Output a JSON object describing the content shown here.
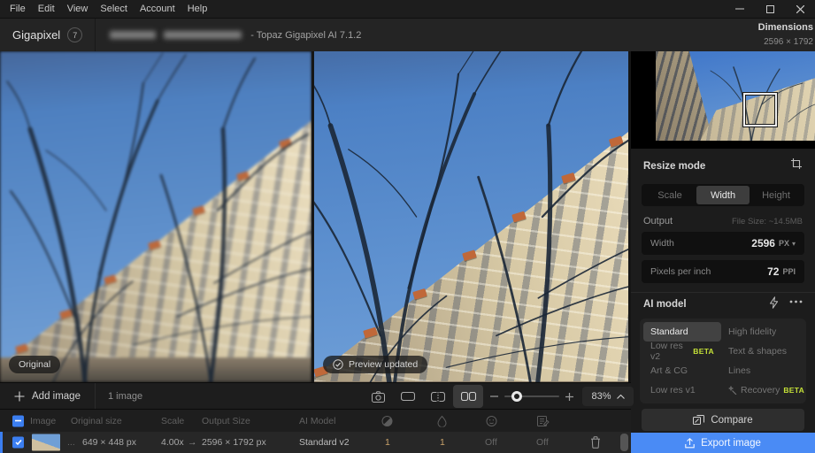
{
  "menu": {
    "items": [
      "File",
      "Edit",
      "View",
      "Select",
      "Account",
      "Help"
    ]
  },
  "titlebar": {
    "app_name": "Gigapixel",
    "version_badge": "7",
    "title_suffix": "- Topaz Gigapixel AI 7.1.2",
    "dimensions_label": "Dimensions",
    "dimensions_value": "2596 × 1792"
  },
  "preview": {
    "original_label": "Original",
    "updated_label": "Preview updated"
  },
  "sidebar": {
    "resize_mode": {
      "label": "Resize mode",
      "tabs": [
        {
          "label": "Scale",
          "active": false
        },
        {
          "label": "Width",
          "active": true
        },
        {
          "label": "Height",
          "active": false
        }
      ]
    },
    "output": {
      "label": "Output",
      "file_size": "File Size: ~14.5MB",
      "width_label": "Width",
      "width_value": "2596",
      "width_unit": "PX",
      "width_caret": "▾",
      "ppi_label": "Pixels per inch",
      "ppi_value": "72",
      "ppi_unit": "PPI"
    },
    "ai_model": {
      "label": "AI model",
      "beta_label": "BETA",
      "models": [
        {
          "label": "Standard",
          "active": true
        },
        {
          "label": "High fidelity",
          "active": false
        },
        {
          "label": "Low res v2",
          "active": false,
          "beta": true
        },
        {
          "label": "Text & shapes",
          "active": false
        },
        {
          "label": "Art & CG",
          "active": false
        },
        {
          "label": "Lines",
          "active": false
        },
        {
          "label": "Low res v1",
          "active": false
        },
        {
          "label": "Recovery",
          "active": false,
          "beta": true
        }
      ]
    },
    "compare_label": "Compare",
    "export_label": "Export image"
  },
  "toolbar": {
    "add_image_label": "Add image",
    "image_count": "1 image",
    "zoom_value": "83%"
  },
  "table": {
    "headers": [
      "Image",
      "Original size",
      "Scale",
      "Output Size",
      "AI Model"
    ],
    "row": {
      "ellipsis": "...",
      "original_size": "649 × 448 px",
      "scale": "4.00x",
      "arrow": "→",
      "output_size": "2596 × 1792 px",
      "ai_model": "Standard v2",
      "sharpen": "1",
      "denoise": "1",
      "face_recovery": "Off",
      "text_recovery": "Off"
    }
  },
  "icons": {
    "crop": "crop-frame",
    "lightning": "bolt",
    "more": "ellipsis",
    "camera": "camera",
    "single_view": "rect",
    "split_view": "split-rect",
    "side_by_side": "two-rects",
    "zoom_out": "minus",
    "zoom_in": "plus",
    "collapse": "chevron-up",
    "compare": "overlap-squares",
    "export": "upload-arrow",
    "check": "check-circle",
    "sharpen": "contrast-circle",
    "denoise": "droplet",
    "face_recovery": "face",
    "text_recovery": "document",
    "delete": "trash",
    "minimize": "minus",
    "maximize": "square",
    "close": "x"
  },
  "colors": {
    "accent_blue": "#4a8bf5",
    "checkbox_blue": "#3b7ef0",
    "beta_green": "#c5e138",
    "amber_value": "#c9a26a"
  }
}
